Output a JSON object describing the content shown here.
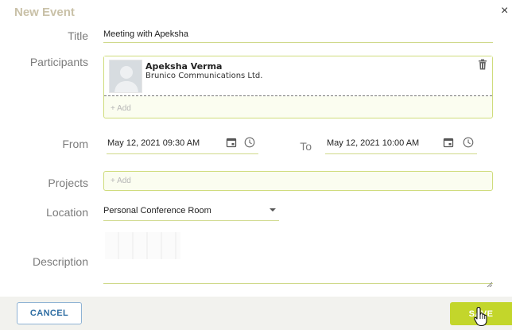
{
  "dialog": {
    "title": "New Event",
    "close_glyph": "×"
  },
  "fields": {
    "title_label": "Title",
    "title_value": "Meeting with Apeksha",
    "participants_label": "Participants",
    "participants": [
      {
        "name": "Apeksha Verma",
        "organization": "Brunico Communications Ltd."
      }
    ],
    "participants_add": "+ Add",
    "from_label": "From",
    "from_value": "May 12, 2021 09:30 AM",
    "to_label": "To",
    "to_value": "May 12, 2021 10:00 AM",
    "projects_label": "Projects",
    "projects_add": "+ Add",
    "location_label": "Location",
    "location_value": "Personal Conference Room",
    "description_label": "Description"
  },
  "buttons": {
    "cancel": "CANCEL",
    "save": "SAVE"
  },
  "colors": {
    "accent": "#c3d62b",
    "field_border": "#cfdc7c",
    "cancel_text": "#2f6ea3",
    "title_text": "#c9c1a8"
  }
}
